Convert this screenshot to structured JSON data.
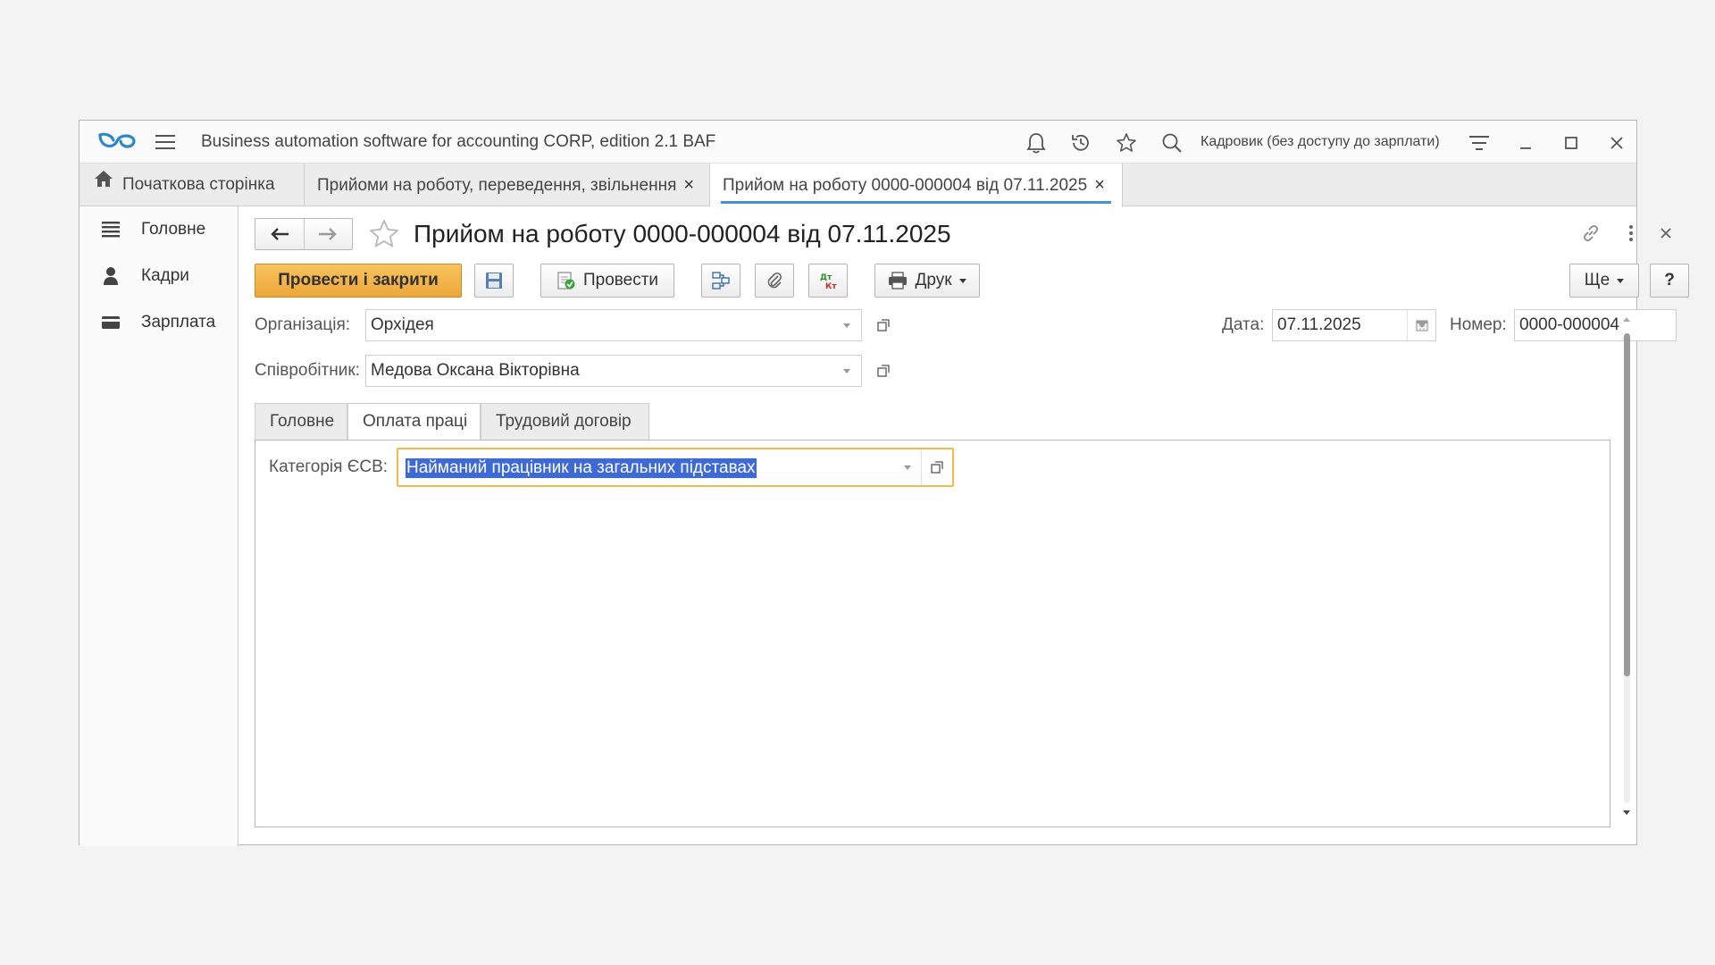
{
  "app": {
    "title": "Business automation software for accounting CORP, edition 2.1 BAF",
    "user": "Кадровик (без доступу до зарплати)",
    "accent_color": "#4a90d9",
    "logo_color": "#2e87c8"
  },
  "tabs": [
    {
      "label": "Початкова сторінка",
      "icon": "home-icon"
    },
    {
      "label": "Прийоми на роботу, переведення, звільнення",
      "close": "×"
    },
    {
      "label": "Прийом на роботу 0000-000004 від 07.11.2025",
      "close": "×",
      "active": true
    }
  ],
  "sidebar": {
    "items": [
      {
        "label": "Головне",
        "icon": "list-icon"
      },
      {
        "label": "Кадри",
        "icon": "person-icon"
      },
      {
        "label": "Зарплата",
        "icon": "card-icon"
      }
    ]
  },
  "form": {
    "title": "Прийом на роботу 0000-000004 від 07.11.2025",
    "toolbar": {
      "post_close": "Провести і закрити",
      "post": "Провести",
      "print": "Друк",
      "more": "Ще",
      "help": "?",
      "primary_color": "#eca73a"
    },
    "organization": {
      "label": "Організація:",
      "value": "Орхідея"
    },
    "date": {
      "label": "Дата:",
      "value": "07.11.2025"
    },
    "number": {
      "label": "Номер:",
      "value": "0000-000004"
    },
    "employee": {
      "label": "Співробітник:",
      "value": "Медова Оксана Вікторівна"
    },
    "inner_tabs": [
      {
        "label": "Головне"
      },
      {
        "label": "Оплата праці",
        "active": true
      },
      {
        "label": "Трудовий договір"
      }
    ],
    "esv": {
      "label": "Категорія ЄСВ:",
      "value": "Найманий працівник на загальних підставах",
      "focus_color": "#f3b94a",
      "selection_color": "#3d6ad7"
    }
  }
}
